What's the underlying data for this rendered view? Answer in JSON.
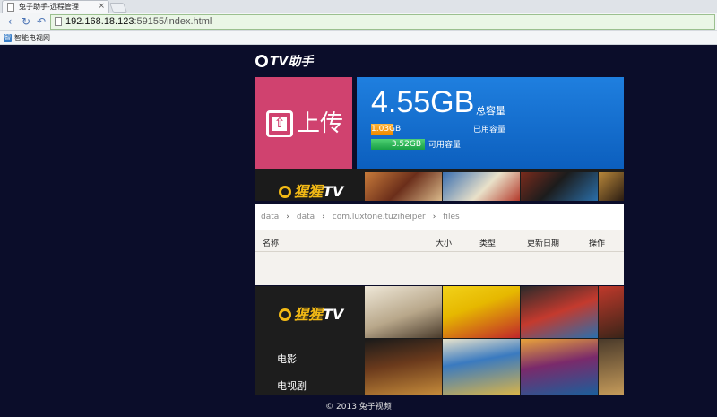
{
  "browser": {
    "tab_title": "兔子助手-远程管理",
    "url_host": "192.168.18.123",
    "url_rest": ":59155/index.html",
    "bookmark": "智能电视网"
  },
  "header": {
    "logo_text": "TV助手"
  },
  "upload": {
    "label": "上传"
  },
  "storage": {
    "total": "4.55GB",
    "total_label": "总容量",
    "used_value": "1.03GB",
    "used_label": "已用容量",
    "used_fraction": 0.23,
    "avail_value": "3.52GB",
    "avail_label": "可用容量",
    "avail_fraction": 0.77
  },
  "brand": {
    "name_cn": "猩猩",
    "name_tv": "TV"
  },
  "breadcrumb": [
    "data",
    "data",
    "com.luxtone.tuziheiper",
    "files"
  ],
  "table": {
    "headers": {
      "name": "名称",
      "size": "大小",
      "type": "类型",
      "date": "更新日期",
      "action": "操作"
    }
  },
  "menu": {
    "items": [
      "电影",
      "电视剧"
    ]
  },
  "footer": {
    "copyright": "© 2013 兔子视频"
  },
  "colors": {
    "accent_pink": "#d0426f",
    "accent_blue": "#1f7fdf",
    "used_orange": "#f08a00",
    "avail_green": "#19a045",
    "brand_yellow": "#f2b915"
  }
}
